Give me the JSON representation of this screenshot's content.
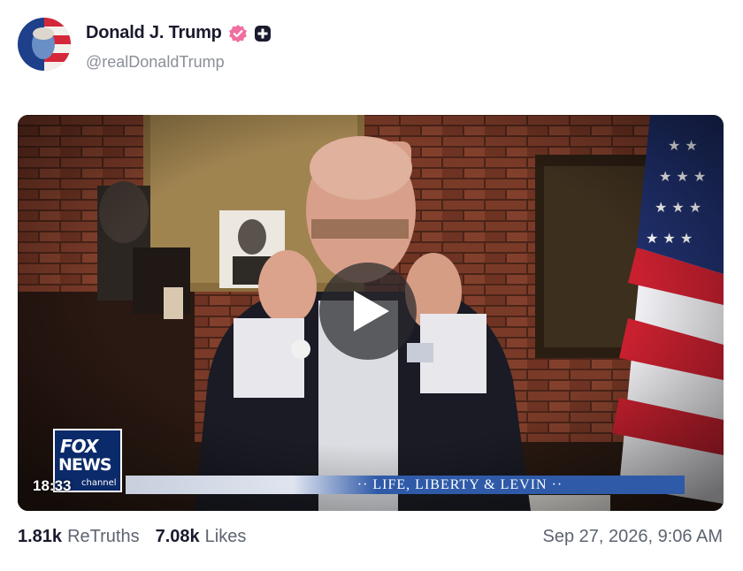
{
  "post": {
    "author": {
      "display_name": "Donald J. Trump",
      "handle": "@realDonaldTrump",
      "verified_icon": "verified-badge-icon",
      "plus_icon": "plus-badge-icon",
      "avatar": "avatar"
    },
    "video": {
      "duration": "18:33",
      "play_icon": "play-icon",
      "overlay": {
        "network_logo": [
          "FOX",
          "NEWS",
          "channel"
        ],
        "chyron": "·· LIFE, LIBERTY & LEVIN ··"
      }
    },
    "stats": {
      "retruths_count": "1.81k",
      "retruths_label": "ReTruths",
      "likes_count": "7.08k",
      "likes_label": "Likes"
    },
    "timestamp": "Sep 27, 2026, 9:06 AM"
  },
  "colors": {
    "verified": "#f06ea0",
    "muted_text": "#5d6470",
    "handle_text": "#8a8f98",
    "name_text": "#1a1a2e"
  }
}
